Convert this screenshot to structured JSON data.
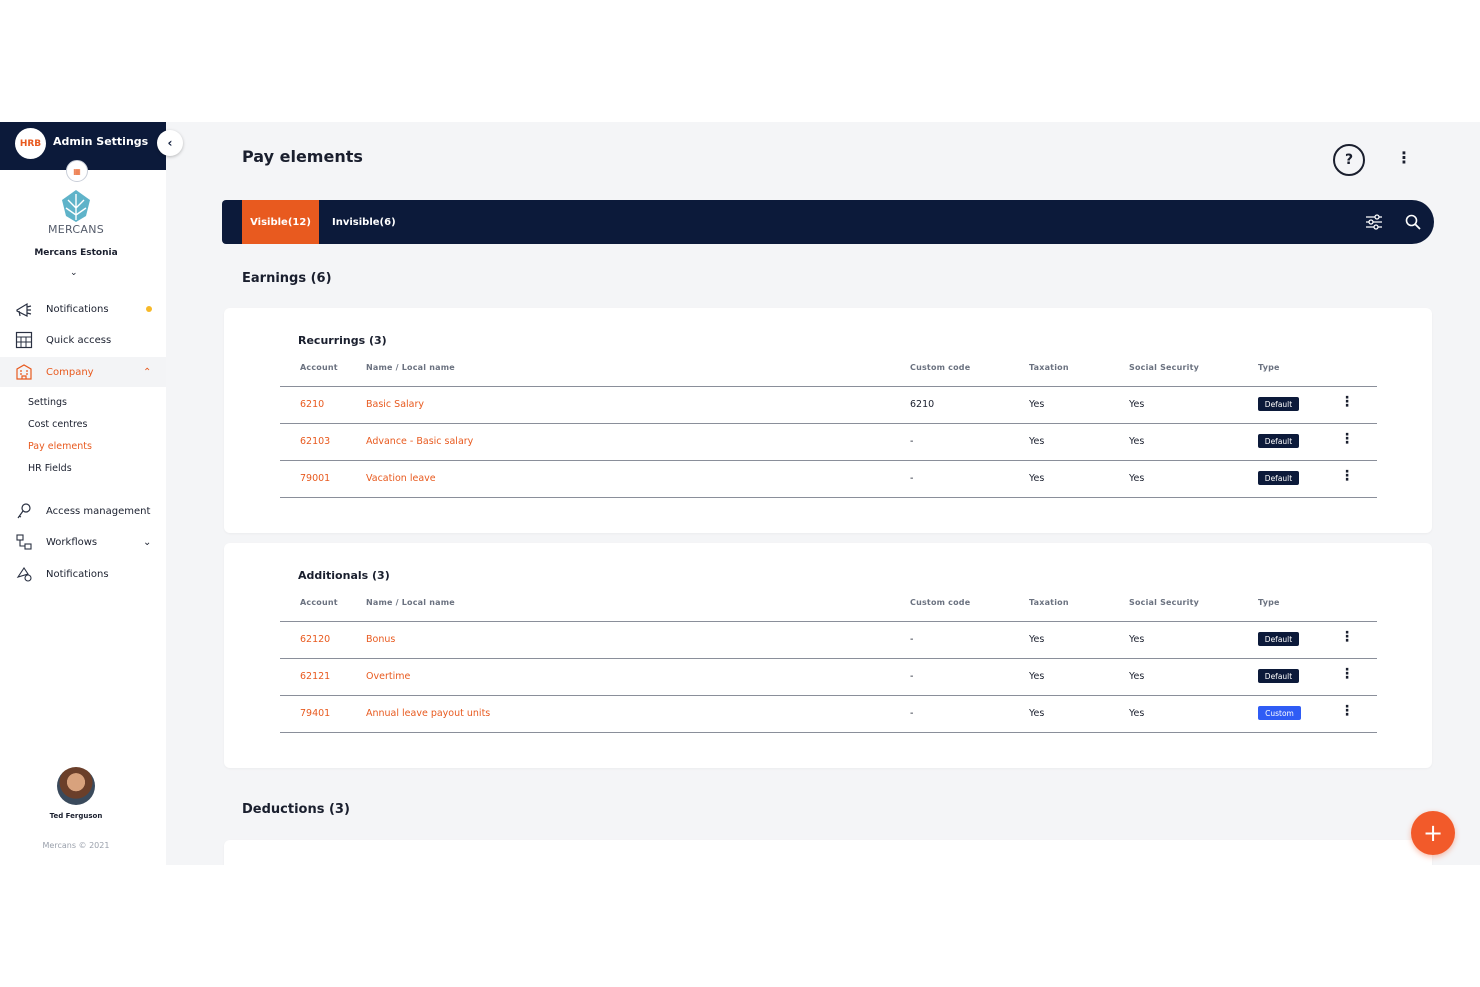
{
  "sidebar": {
    "brand": "HRB",
    "title": "Admin Settings",
    "collapse_glyph": "‹",
    "grid_glyph": "▦",
    "company_word": "MERCANS",
    "company_name": "Mercans Estonia",
    "nav": [
      {
        "label": "Notifications",
        "icon": "megaphone-icon"
      },
      {
        "label": "Quick access",
        "icon": "calculator-icon"
      },
      {
        "label": "Company",
        "icon": "building-icon"
      }
    ],
    "company_sub": [
      "Settings",
      "Cost centres",
      "Pay elements",
      "HR Fields"
    ],
    "nav2": [
      {
        "label": "Access management",
        "icon": "key-icon"
      },
      {
        "label": "Workflows",
        "icon": "workflow-icon"
      },
      {
        "label": "Notifications",
        "icon": "bell-settings-icon"
      }
    ],
    "user_name": "Ted Ferguson",
    "copyright": "Mercans © 2021"
  },
  "header": {
    "title": "Pay elements",
    "help": "?",
    "menu": "⋮"
  },
  "tabs": {
    "visible": "Visible(12)",
    "invisible": "Invisible(6)"
  },
  "earnings": {
    "title": "Earnings (6)"
  },
  "columns": {
    "account": "Account",
    "name": "Name / Local name",
    "code": "Custom code",
    "tax": "Taxation",
    "ss": "Social Security",
    "type": "Type"
  },
  "recurrings": {
    "title": "Recurrings (3)",
    "rows": [
      {
        "account": "6210",
        "name": "Basic Salary",
        "code": "6210",
        "tax": "Yes",
        "ss": "Yes",
        "type": "Default"
      },
      {
        "account": "62103",
        "name": "Advance - Basic salary",
        "code": "-",
        "tax": "Yes",
        "ss": "Yes",
        "type": "Default"
      },
      {
        "account": "79001",
        "name": "Vacation leave",
        "code": "-",
        "tax": "Yes",
        "ss": "Yes",
        "type": "Default"
      }
    ]
  },
  "additionals": {
    "title": "Additionals (3)",
    "rows": [
      {
        "account": "62120",
        "name": "Bonus",
        "code": "-",
        "tax": "Yes",
        "ss": "Yes",
        "type": "Default"
      },
      {
        "account": "62121",
        "name": "Overtime",
        "code": "-",
        "tax": "Yes",
        "ss": "Yes",
        "type": "Default"
      },
      {
        "account": "79401",
        "name": "Annual leave payout units",
        "code": "-",
        "tax": "Yes",
        "ss": "Yes",
        "type": "Custom"
      }
    ]
  },
  "deductions": {
    "title": "Deductions (3)"
  },
  "row_menu": "⋮",
  "fab": "+",
  "colors": {
    "navy": "#0c1a3a",
    "accent": "#e85a1f",
    "custom_badge": "#2f5cf5"
  }
}
